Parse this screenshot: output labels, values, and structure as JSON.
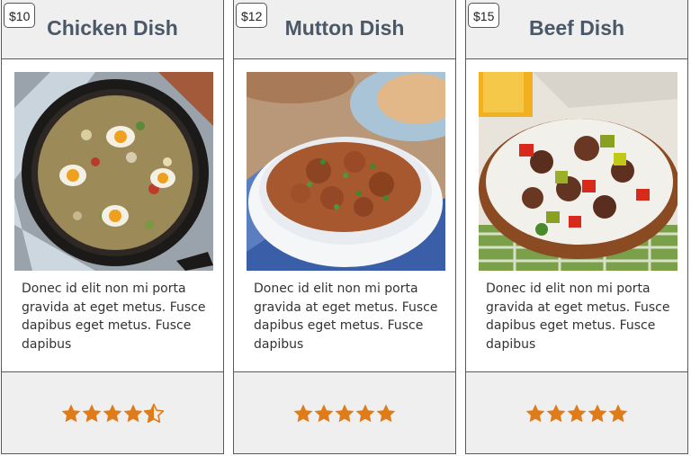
{
  "colors": {
    "star": "#e07b1a",
    "title": "#4a5868",
    "header_bg": "#efefef",
    "border": "#5a5a5a"
  },
  "cards": [
    {
      "price": "$10",
      "title": "Chicken Dish",
      "image": "chicken-skillet-photo",
      "description": "Donec id elit non mi porta gravida at eget metus. Fusce dapibus eget metus. Fusce dapibus",
      "rating": 4.5,
      "rating_max": 5
    },
    {
      "price": "$12",
      "title": "Mutton Dish",
      "image": "mutton-curry-photo",
      "description": "Donec id elit non mi porta gravida at eget metus. Fusce dapibus eget metus. Fusce dapibus",
      "rating": 5,
      "rating_max": 5
    },
    {
      "price": "$15",
      "title": "Beef Dish",
      "image": "beef-rice-photo",
      "description": "Donec id elit non mi porta gravida at eget metus. Fusce dapibus eget metus. Fusce dapibus",
      "rating": 5,
      "rating_max": 5
    }
  ]
}
